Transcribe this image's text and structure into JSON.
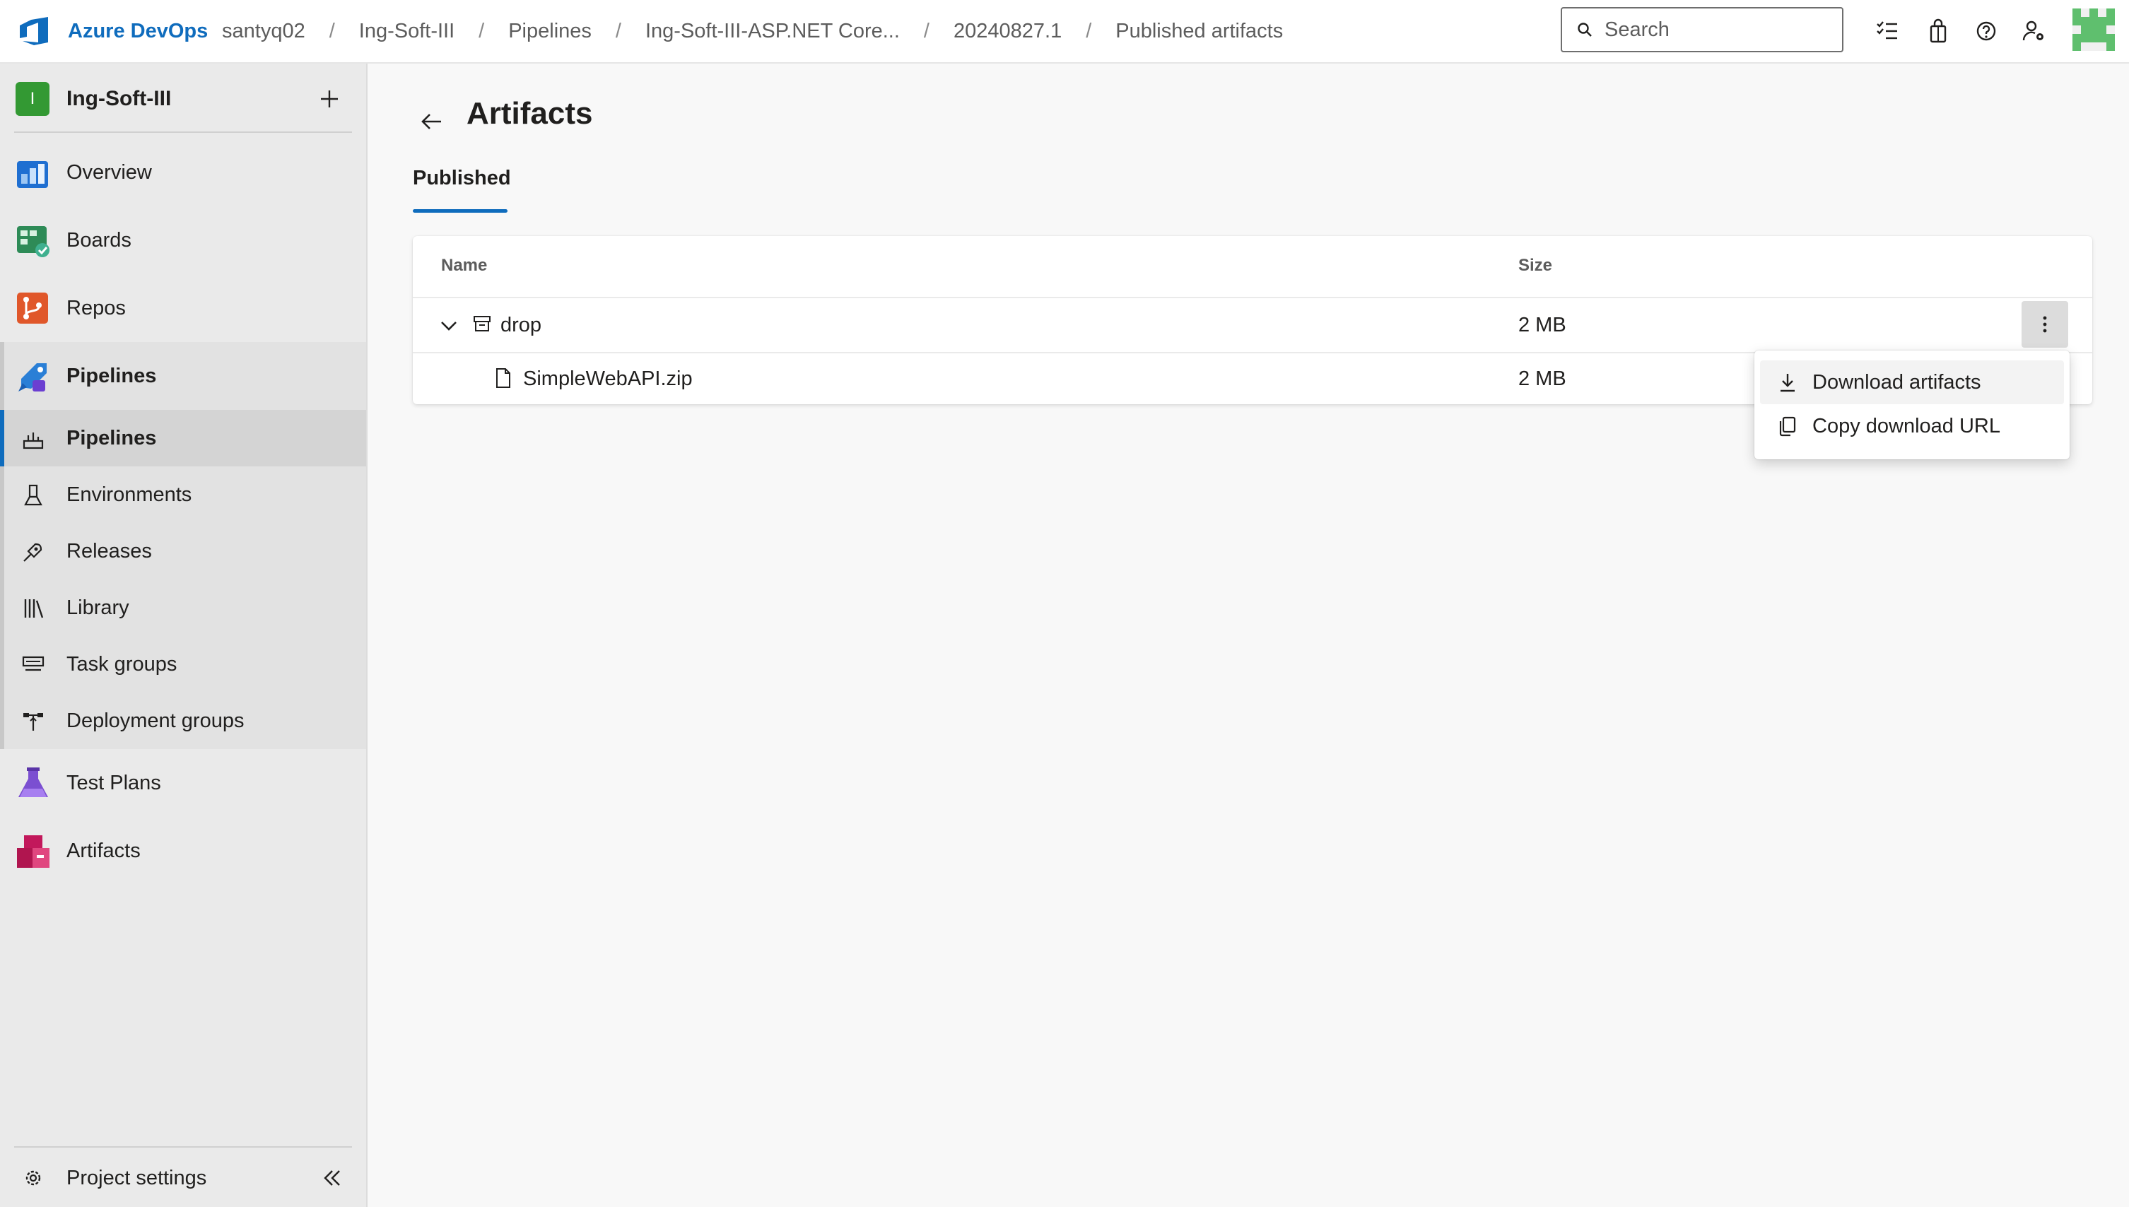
{
  "header": {
    "brand": "Azure DevOps",
    "breadcrumbs": [
      "santyq02",
      "Ing-Soft-III",
      "Pipelines",
      "Ing-Soft-III-ASP.NET Core...",
      "20240827.1",
      "Published artifacts"
    ],
    "search_placeholder": "Search",
    "icons": [
      "checklist-icon",
      "shopping-bag-icon",
      "help-icon",
      "user-settings-icon",
      "avatar-icon"
    ]
  },
  "sidebar": {
    "project_initial": "I",
    "project_name": "Ing-Soft-III",
    "items": [
      {
        "label": "Overview",
        "icon": "overview-icon"
      },
      {
        "label": "Boards",
        "icon": "boards-icon"
      },
      {
        "label": "Repos",
        "icon": "repos-icon"
      },
      {
        "label": "Pipelines",
        "icon": "pipelines-icon"
      },
      {
        "label": "Test Plans",
        "icon": "test-plans-icon"
      },
      {
        "label": "Artifacts",
        "icon": "artifacts-icon"
      }
    ],
    "pipelines_sub": [
      {
        "label": "Pipelines",
        "icon": "pipelines-sub-icon",
        "selected": true
      },
      {
        "label": "Environments",
        "icon": "environments-icon"
      },
      {
        "label": "Releases",
        "icon": "releases-icon"
      },
      {
        "label": "Library",
        "icon": "library-icon"
      },
      {
        "label": "Task groups",
        "icon": "task-groups-icon"
      },
      {
        "label": "Deployment groups",
        "icon": "deployment-groups-icon"
      }
    ],
    "project_settings": "Project settings"
  },
  "main": {
    "title": "Artifacts",
    "tab": "Published",
    "table": {
      "columns": [
        "Name",
        "Size"
      ],
      "rows": [
        {
          "name": "drop",
          "size": "2 MB",
          "type": "folder",
          "expanded": true
        },
        {
          "name": "SimpleWebAPI.zip",
          "size": "2 MB",
          "type": "file"
        }
      ]
    },
    "context_menu": {
      "items": [
        {
          "label": "Download artifacts",
          "icon": "download-icon"
        },
        {
          "label": "Copy download URL",
          "icon": "copy-icon"
        }
      ]
    }
  },
  "colors": {
    "accent": "#0f6cbd",
    "project_badge": "#339933"
  }
}
